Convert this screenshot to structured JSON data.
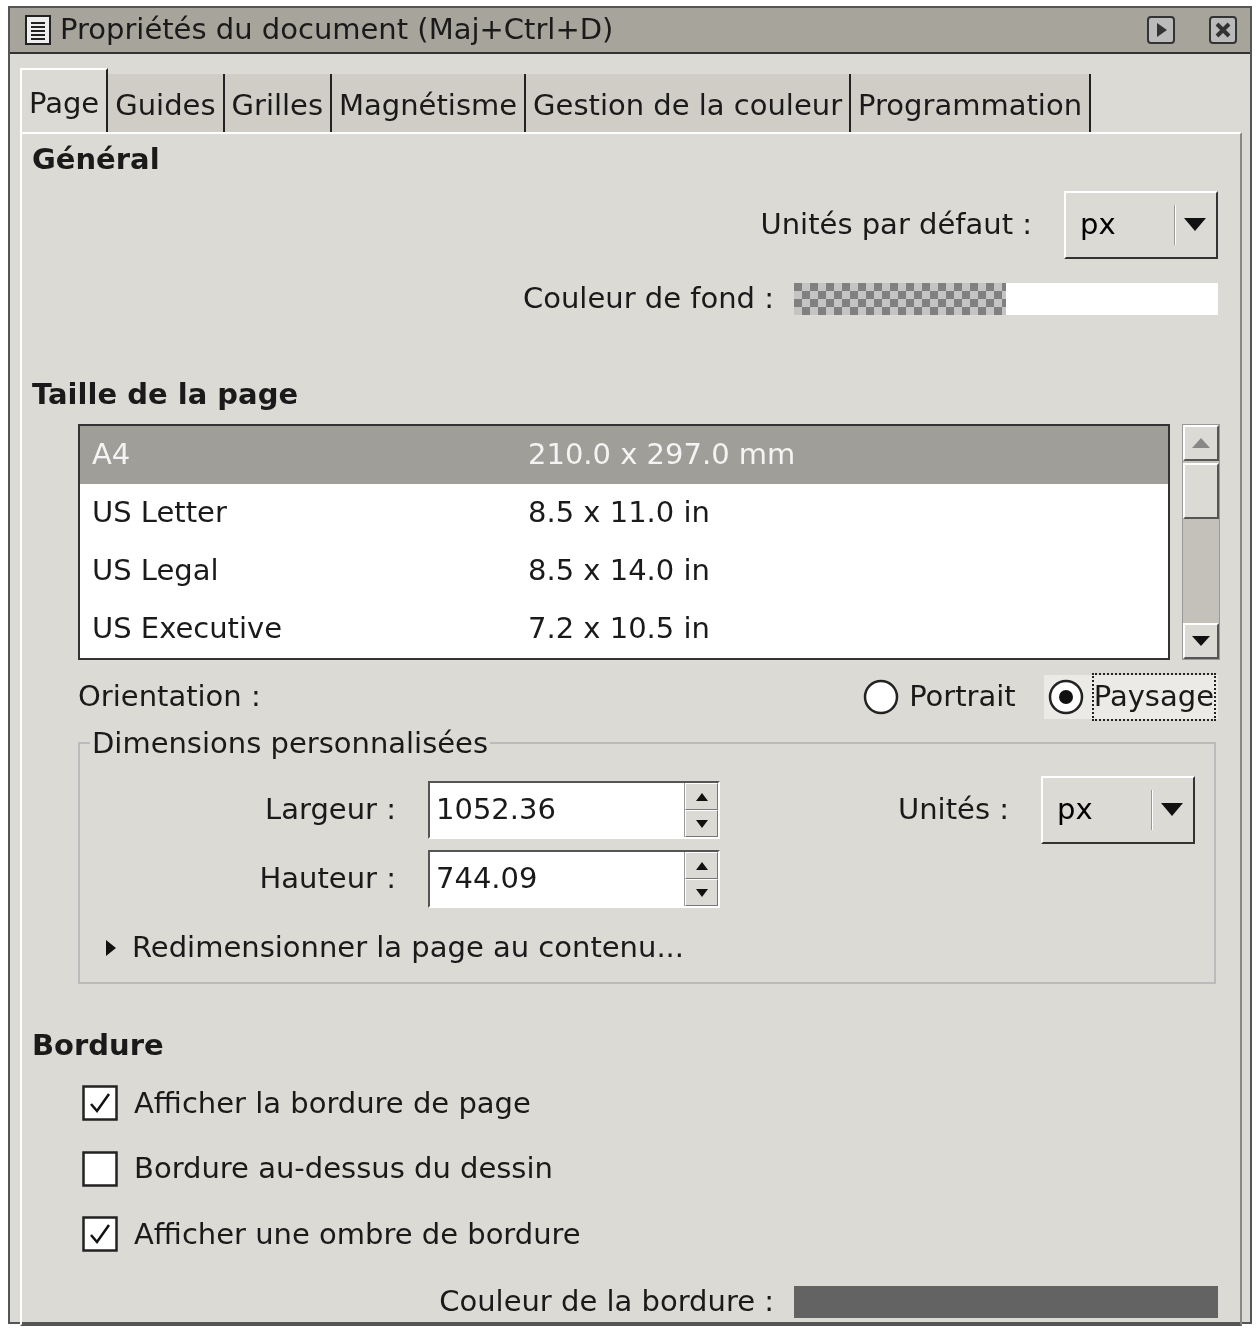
{
  "window": {
    "title": "Propriétés du document (Maj+Ctrl+D)"
  },
  "tabs": [
    {
      "label": "Page",
      "selected": true
    },
    {
      "label": "Guides",
      "selected": false
    },
    {
      "label": "Grilles",
      "selected": false
    },
    {
      "label": "Magnétisme",
      "selected": false
    },
    {
      "label": "Gestion de la couleur",
      "selected": false
    },
    {
      "label": "Programmation",
      "selected": false
    }
  ],
  "general": {
    "heading": "Général",
    "default_units": {
      "label": "Unités par défaut :",
      "value": "px"
    },
    "background_color": {
      "label": "Couleur de fond :"
    }
  },
  "page_size": {
    "heading": "Taille de la page",
    "rows": [
      {
        "name": "A4",
        "size": "210.0 x 297.0 mm",
        "selected": true
      },
      {
        "name": "US Letter",
        "size": "8.5 x 11.0 in",
        "selected": false
      },
      {
        "name": "US Legal",
        "size": "8.5 x 14.0 in",
        "selected": false
      },
      {
        "name": "US Executive",
        "size": "7.2 x 10.5 in",
        "selected": false
      }
    ]
  },
  "orientation": {
    "label": "Orientation :",
    "options": [
      {
        "label": "Portrait",
        "selected": false
      },
      {
        "label": "Paysage",
        "selected": true
      }
    ]
  },
  "custom": {
    "legend": "Dimensions personnalisées",
    "width": {
      "label": "Largeur :",
      "value": "1052.36"
    },
    "height": {
      "label": "Hauteur :",
      "value": "744.09"
    },
    "units": {
      "label": "Unités :",
      "value": "px"
    },
    "resize": {
      "label": "Redimensionner la page au contenu...",
      "expanded": false
    }
  },
  "border": {
    "heading": "Bordure",
    "options": [
      {
        "label": "Afficher la bordure de page",
        "checked": true
      },
      {
        "label": "Bordure au-dessus du dessin",
        "checked": false
      },
      {
        "label": "Afficher une ombre de bordure",
        "checked": true
      }
    ],
    "color": {
      "label": "Couleur de la bordure :"
    }
  }
}
